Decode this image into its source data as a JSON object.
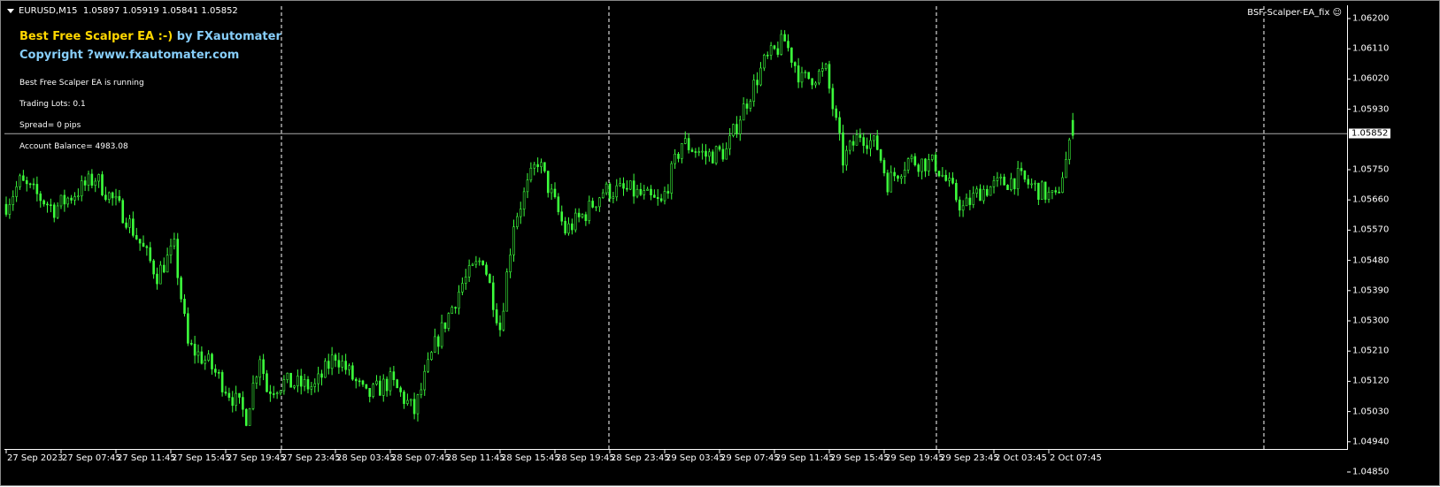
{
  "header": {
    "symbol_line": "EURUSD,M15  1.05897 1.05919 1.05841 1.05852",
    "ea_name": "BSF-Scalper-EA_fix"
  },
  "overlay": {
    "title_yellow": "Best Free Scalper EA :-)",
    "title_blue": " by FXautomater",
    "copyright": "Copyright ?www.fxautomater.com",
    "status": "Best Free Scalper EA is running",
    "lots": "Trading Lots:  0.1",
    "spread": "Spread= 0 pips",
    "balance": "Account Balance= 4983.08"
  },
  "colors": {
    "candle": "#3cff3c",
    "yellow": "#ffd700",
    "blue": "#87cefa",
    "grid": "#ffffff"
  },
  "chart_data": {
    "type": "candlestick",
    "symbol": "EURUSD",
    "timeframe": "M15",
    "ohlc_last": {
      "open": 1.05897,
      "high": 1.05919,
      "low": 1.05841,
      "close": 1.05852
    },
    "bid": "1.05852",
    "ylim": [
      1.0485,
      1.062
    ],
    "price_ticks": [
      "1.06200",
      "1.06110",
      "1.06020",
      "1.05930",
      "1.05750",
      "1.05660",
      "1.05570",
      "1.05480",
      "1.05390",
      "1.05300",
      "1.05210",
      "1.05120",
      "1.05030",
      "1.04940",
      "1.04850"
    ],
    "time_ticks": [
      "27 Sep 2023",
      "27 Sep 07:45",
      "27 Sep 11:45",
      "27 Sep 15:45",
      "27 Sep 19:45",
      "27 Sep 23:45",
      "28 Sep 03:45",
      "28 Sep 07:45",
      "28 Sep 11:45",
      "28 Sep 15:45",
      "28 Sep 19:45",
      "28 Sep 23:45",
      "29 Sep 03:45",
      "29 Sep 07:45",
      "29 Sep 11:45",
      "29 Sep 15:45",
      "29 Sep 19:45",
      "29 Sep 23:45",
      "2 Oct 03:45",
      "2 Oct 07:45"
    ],
    "bars_per_tick": 16,
    "close_waypoints": [
      [
        0,
        1.05647
      ],
      [
        4,
        1.05713
      ],
      [
        14,
        1.05634
      ],
      [
        26,
        1.05726
      ],
      [
        35,
        1.05608
      ],
      [
        44,
        1.05437
      ],
      [
        49,
        1.05516
      ],
      [
        53,
        1.05226
      ],
      [
        59,
        1.05174
      ],
      [
        70,
        1.05016
      ],
      [
        74,
        1.052
      ],
      [
        76,
        1.05095
      ],
      [
        81,
        1.05116
      ],
      [
        90,
        1.05103
      ],
      [
        96,
        1.052
      ],
      [
        105,
        1.05074
      ],
      [
        112,
        1.05121
      ],
      [
        119,
        1.05029
      ],
      [
        125,
        1.05226
      ],
      [
        133,
        1.05411
      ],
      [
        139,
        1.05489
      ],
      [
        144,
        1.05279
      ],
      [
        148,
        1.05595
      ],
      [
        155,
        1.05779
      ],
      [
        163,
        1.05568
      ],
      [
        169,
        1.05621
      ],
      [
        174,
        1.05687
      ],
      [
        182,
        1.05687
      ],
      [
        191,
        1.05647
      ],
      [
        197,
        1.05832
      ],
      [
        204,
        1.05792
      ],
      [
        210,
        1.05805
      ],
      [
        214,
        1.05911
      ],
      [
        221,
        1.06068
      ],
      [
        227,
        1.06134
      ],
      [
        232,
        1.06016
      ],
      [
        239,
        1.06042
      ],
      [
        244,
        1.05779
      ],
      [
        249,
        1.05858
      ],
      [
        254,
        1.05818
      ],
      [
        257,
        1.05713
      ],
      [
        263,
        1.05779
      ],
      [
        271,
        1.05766
      ],
      [
        279,
        1.05634
      ],
      [
        284,
        1.05687
      ],
      [
        295,
        1.05726
      ],
      [
        306,
        1.05661
      ],
      [
        308,
        1.05739
      ],
      [
        311,
        1.05852
      ]
    ]
  }
}
